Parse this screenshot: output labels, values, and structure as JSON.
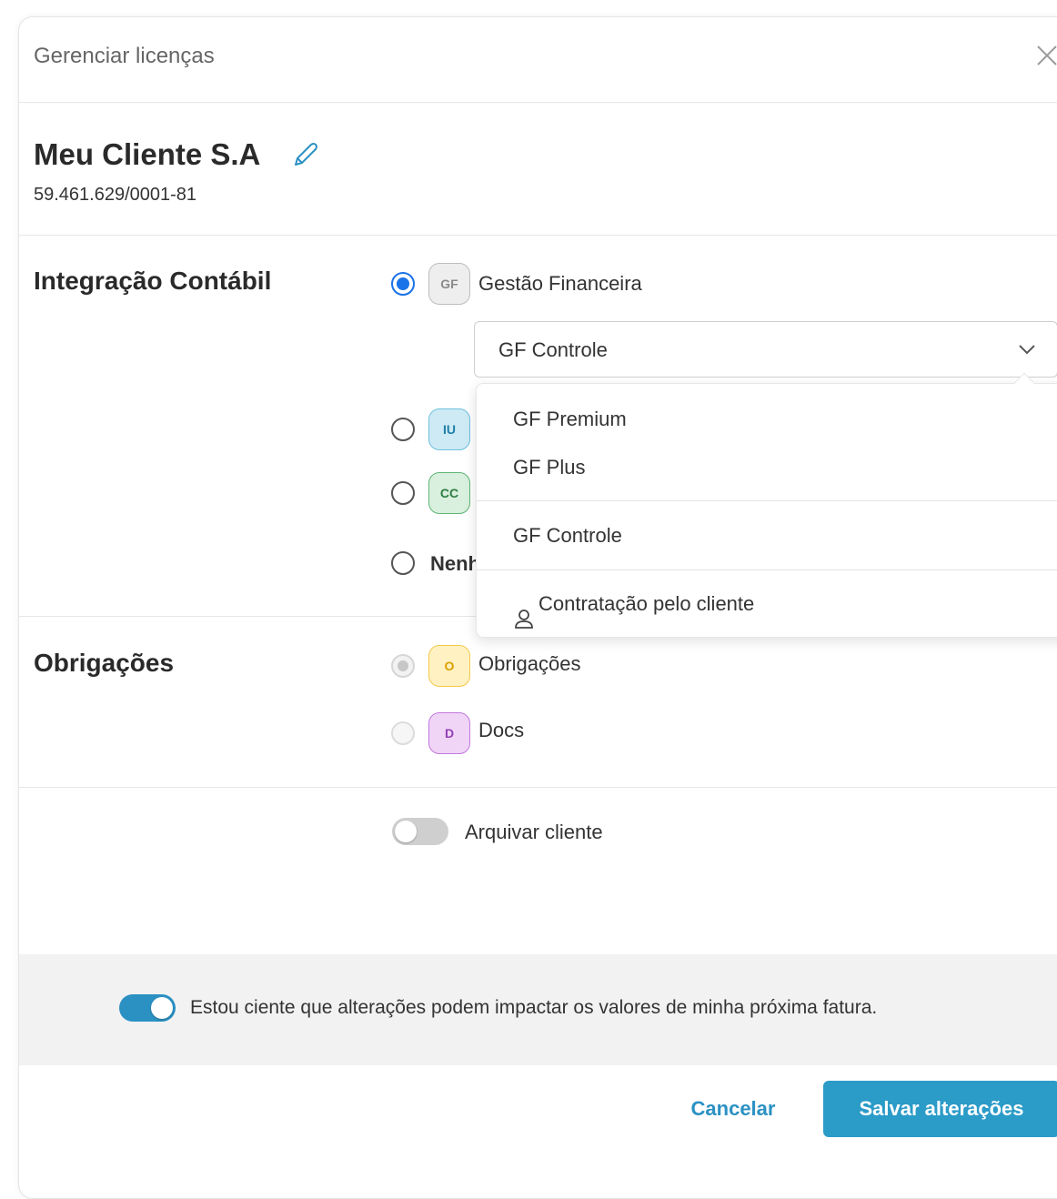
{
  "header": {
    "title": "Gerenciar licenças"
  },
  "client": {
    "name": "Meu Cliente S.A",
    "document": "59.461.629/0001-81"
  },
  "integracao": {
    "title": "Integração Contábil",
    "options": [
      {
        "badge": "GF",
        "label": "Gestão Financeira",
        "selected": true
      },
      {
        "badge": "IU",
        "label": "",
        "selected": false
      },
      {
        "badge": "CC",
        "label": "",
        "selected": false
      },
      {
        "badge": "",
        "label": "Nenh",
        "selected": false
      }
    ],
    "select": {
      "value": "GF Controle",
      "options": [
        "GF Premium",
        "GF Plus",
        "GF Controle",
        "Contratação pelo cliente"
      ]
    }
  },
  "obrigacoes": {
    "title": "Obrigações",
    "options": [
      {
        "badge": "O",
        "label": "Obrigações"
      },
      {
        "badge": "D",
        "label": "Docs"
      }
    ]
  },
  "archive": {
    "label": "Arquivar cliente",
    "on": false
  },
  "notice": {
    "label": "Estou ciente que alterações podem impactar os valores de minha próxima fatura.",
    "on": true
  },
  "footer": {
    "cancel": "Cancelar",
    "save": "Salvar alterações"
  },
  "colors": {
    "accent": "#2b91c3",
    "radio_selected": "#1a73e8"
  }
}
